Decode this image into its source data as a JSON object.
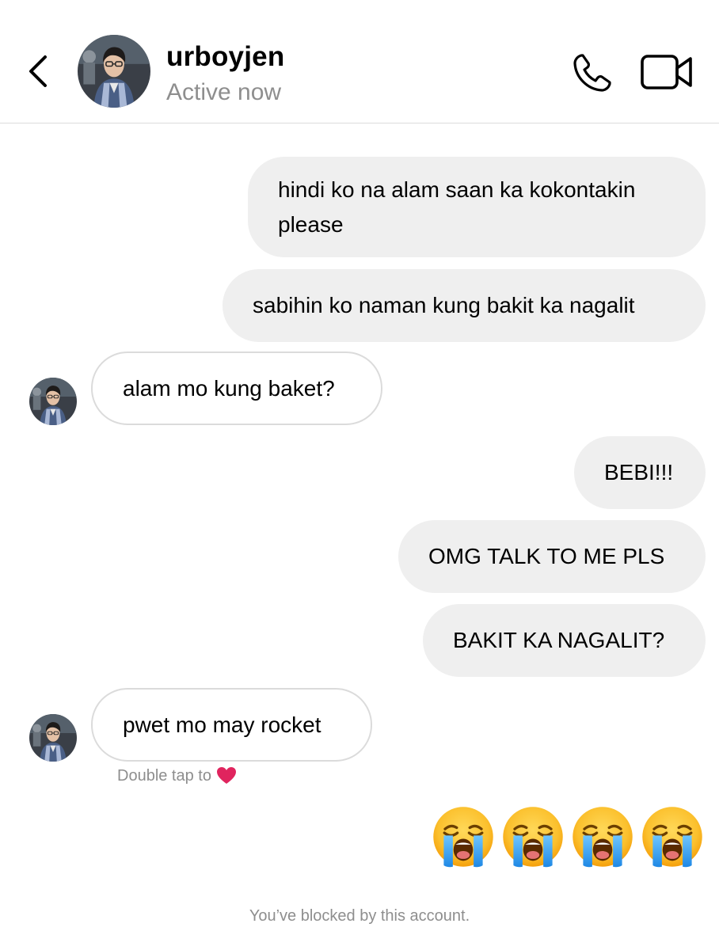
{
  "header": {
    "username": "urboyjen",
    "status": "Active now",
    "back_icon": "chevron-left-icon",
    "call_icon": "phone-icon",
    "video_icon": "video-camera-icon"
  },
  "messages": [
    {
      "direction": "out",
      "text": "hindi ko na alam saan ka kokontakin please"
    },
    {
      "direction": "out",
      "text": "sabihin ko naman kung bakit ka nagalit"
    },
    {
      "direction": "in",
      "text": "alam mo kung baket?"
    },
    {
      "direction": "out",
      "text": "BEBI!!!"
    },
    {
      "direction": "out",
      "text": "OMG TALK TO ME PLS"
    },
    {
      "direction": "out",
      "text": "BAKIT KA NAGALIT?"
    },
    {
      "direction": "in",
      "text": "pwet mo may rocket"
    }
  ],
  "reaction_hint": "Double tap to",
  "reaction_icon": "red-heart-icon",
  "emoji_message": {
    "emoji": "loudly-crying-face-icon",
    "count": 4
  },
  "footer_notice": "You’ve blocked by this account.",
  "colors": {
    "outgoing_bubble": "#efefef",
    "incoming_border": "#dbdbdb",
    "muted_text": "#8e8e8e",
    "heart": "#e0245e"
  }
}
